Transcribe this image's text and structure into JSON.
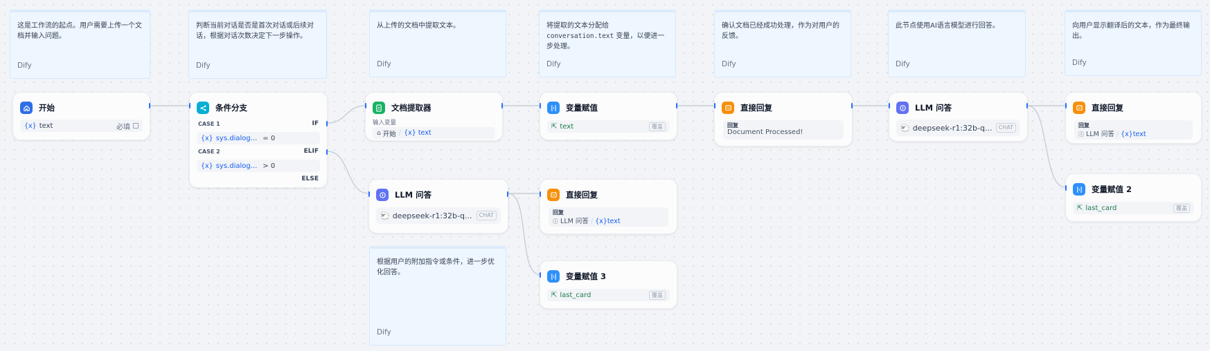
{
  "notes": [
    {
      "text": "这是工作流的起点。用户需要上传一个文档并输入问题。",
      "tag": "Dify"
    },
    {
      "text": "判断当前对话是否是首次对话或后续对话，根据对话次数决定下一步操作。",
      "tag": "Dify"
    },
    {
      "text": "从上传的文档中提取文本。",
      "tag": "Dify"
    },
    {
      "pre": "将提取的文本分配给",
      "code": "conversation.text",
      "post": "变量，以便进一步处理。",
      "tag": "Dify"
    },
    {
      "text": "确认文档已经成功处理，作为对用户的反馈。",
      "tag": "Dify"
    },
    {
      "text": "此节点使用AI语言模型进行回答。",
      "tag": "Dify"
    },
    {
      "text": "向用户显示翻译后的文本，作为最终输出。",
      "tag": "Dify"
    },
    {
      "text": "根据用户的附加指令或条件，进一步优化回答。",
      "tag": "Dify"
    }
  ],
  "start": {
    "title": "开始",
    "var_prefix": "{x}",
    "var_name": "text",
    "required": "必填"
  },
  "ifelse": {
    "title": "条件分支",
    "case1": "CASE 1",
    "if_kw": "IF",
    "cond1_prefix": "{x}",
    "cond1_var": "sys.dialog...",
    "cond1_op": "= 0",
    "case2": "CASE 2",
    "elif_kw": "ELIF",
    "cond2_prefix": "{x}",
    "cond2_var": "sys.dialog...",
    "cond2_op": "> 0",
    "else_kw": "ELSE"
  },
  "extractor": {
    "title": "文档提取器",
    "input_label": "输入变量",
    "src_node": "开始",
    "sep": "/",
    "var_prefix": "{x}",
    "var_name": "text"
  },
  "assign1": {
    "title": "变量赋值",
    "var_name": "text",
    "mode": "覆盖"
  },
  "reply1": {
    "title": "直接回复",
    "label": "回复",
    "text": "Document Processed!"
  },
  "llm1": {
    "title": "LLM 问答",
    "model": "deepseek-r1:32b-q...",
    "mode": "CHAT"
  },
  "reply2": {
    "title": "直接回复",
    "label": "回复",
    "src_node": "LLM 问答",
    "sep": "/",
    "var_prefix": "{x}",
    "var_name": "text"
  },
  "assign2": {
    "title": "变量赋值 2",
    "var_name": "last_card",
    "mode": "覆盖"
  },
  "llm2": {
    "title": "LLM 问答",
    "model": "deepseek-r1:32b-q...",
    "mode": "CHAT"
  },
  "reply3": {
    "title": "直接回复",
    "label": "回复",
    "src_node": "LLM 问答",
    "sep": "/",
    "var_prefix": "{x}",
    "var_name": "text"
  },
  "assign3": {
    "title": "变量赋值 3",
    "var_name": "last_card",
    "mode": "覆盖"
  },
  "colors": {
    "edge": "#c8cdd6",
    "handle": "#2970ff",
    "start": "#2e6ee8",
    "ifelse": "#06aed4",
    "extractor": "#16b364",
    "assigner": "#2e90fa",
    "reply": "#f79009",
    "llm": "#6172f3"
  }
}
